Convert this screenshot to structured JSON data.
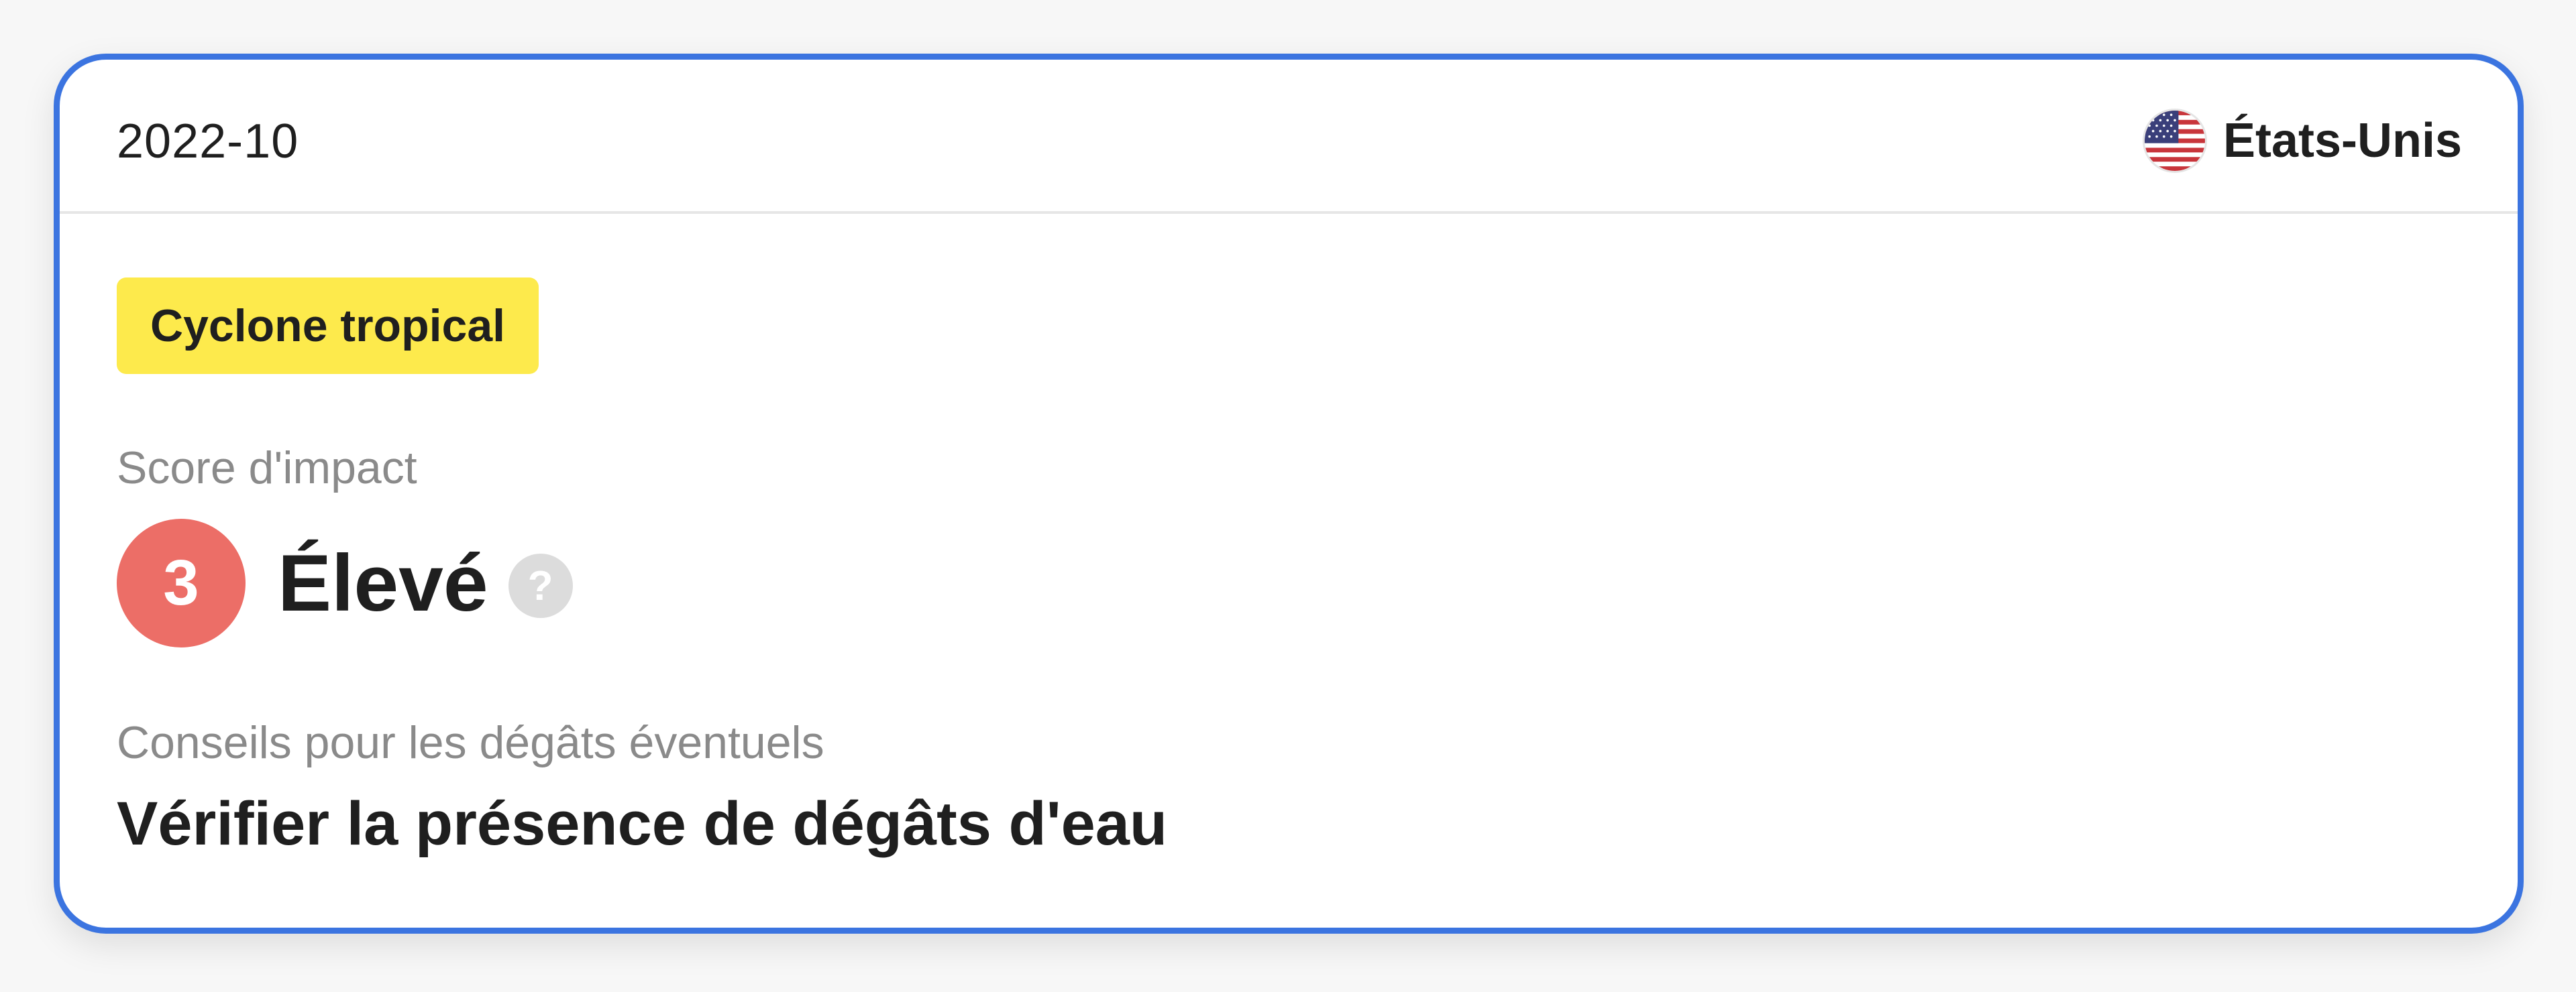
{
  "card": {
    "date": "2022-10",
    "country": {
      "name": "États-Unis",
      "flag_icon": "us-flag-icon"
    },
    "hazard_badge": {
      "label": "Cyclone tropical",
      "color": "#fdea4c"
    },
    "impact": {
      "label": "Score d'impact",
      "score": "3",
      "level": "Élevé",
      "score_color": "#ec6e67",
      "help_icon": "question-mark-icon",
      "help_glyph": "?"
    },
    "advice": {
      "label": "Conseils pour les dégâts éventuels",
      "text": "Vérifier la présence de dégâts d'eau"
    },
    "accent_color": "#3b74e0"
  }
}
